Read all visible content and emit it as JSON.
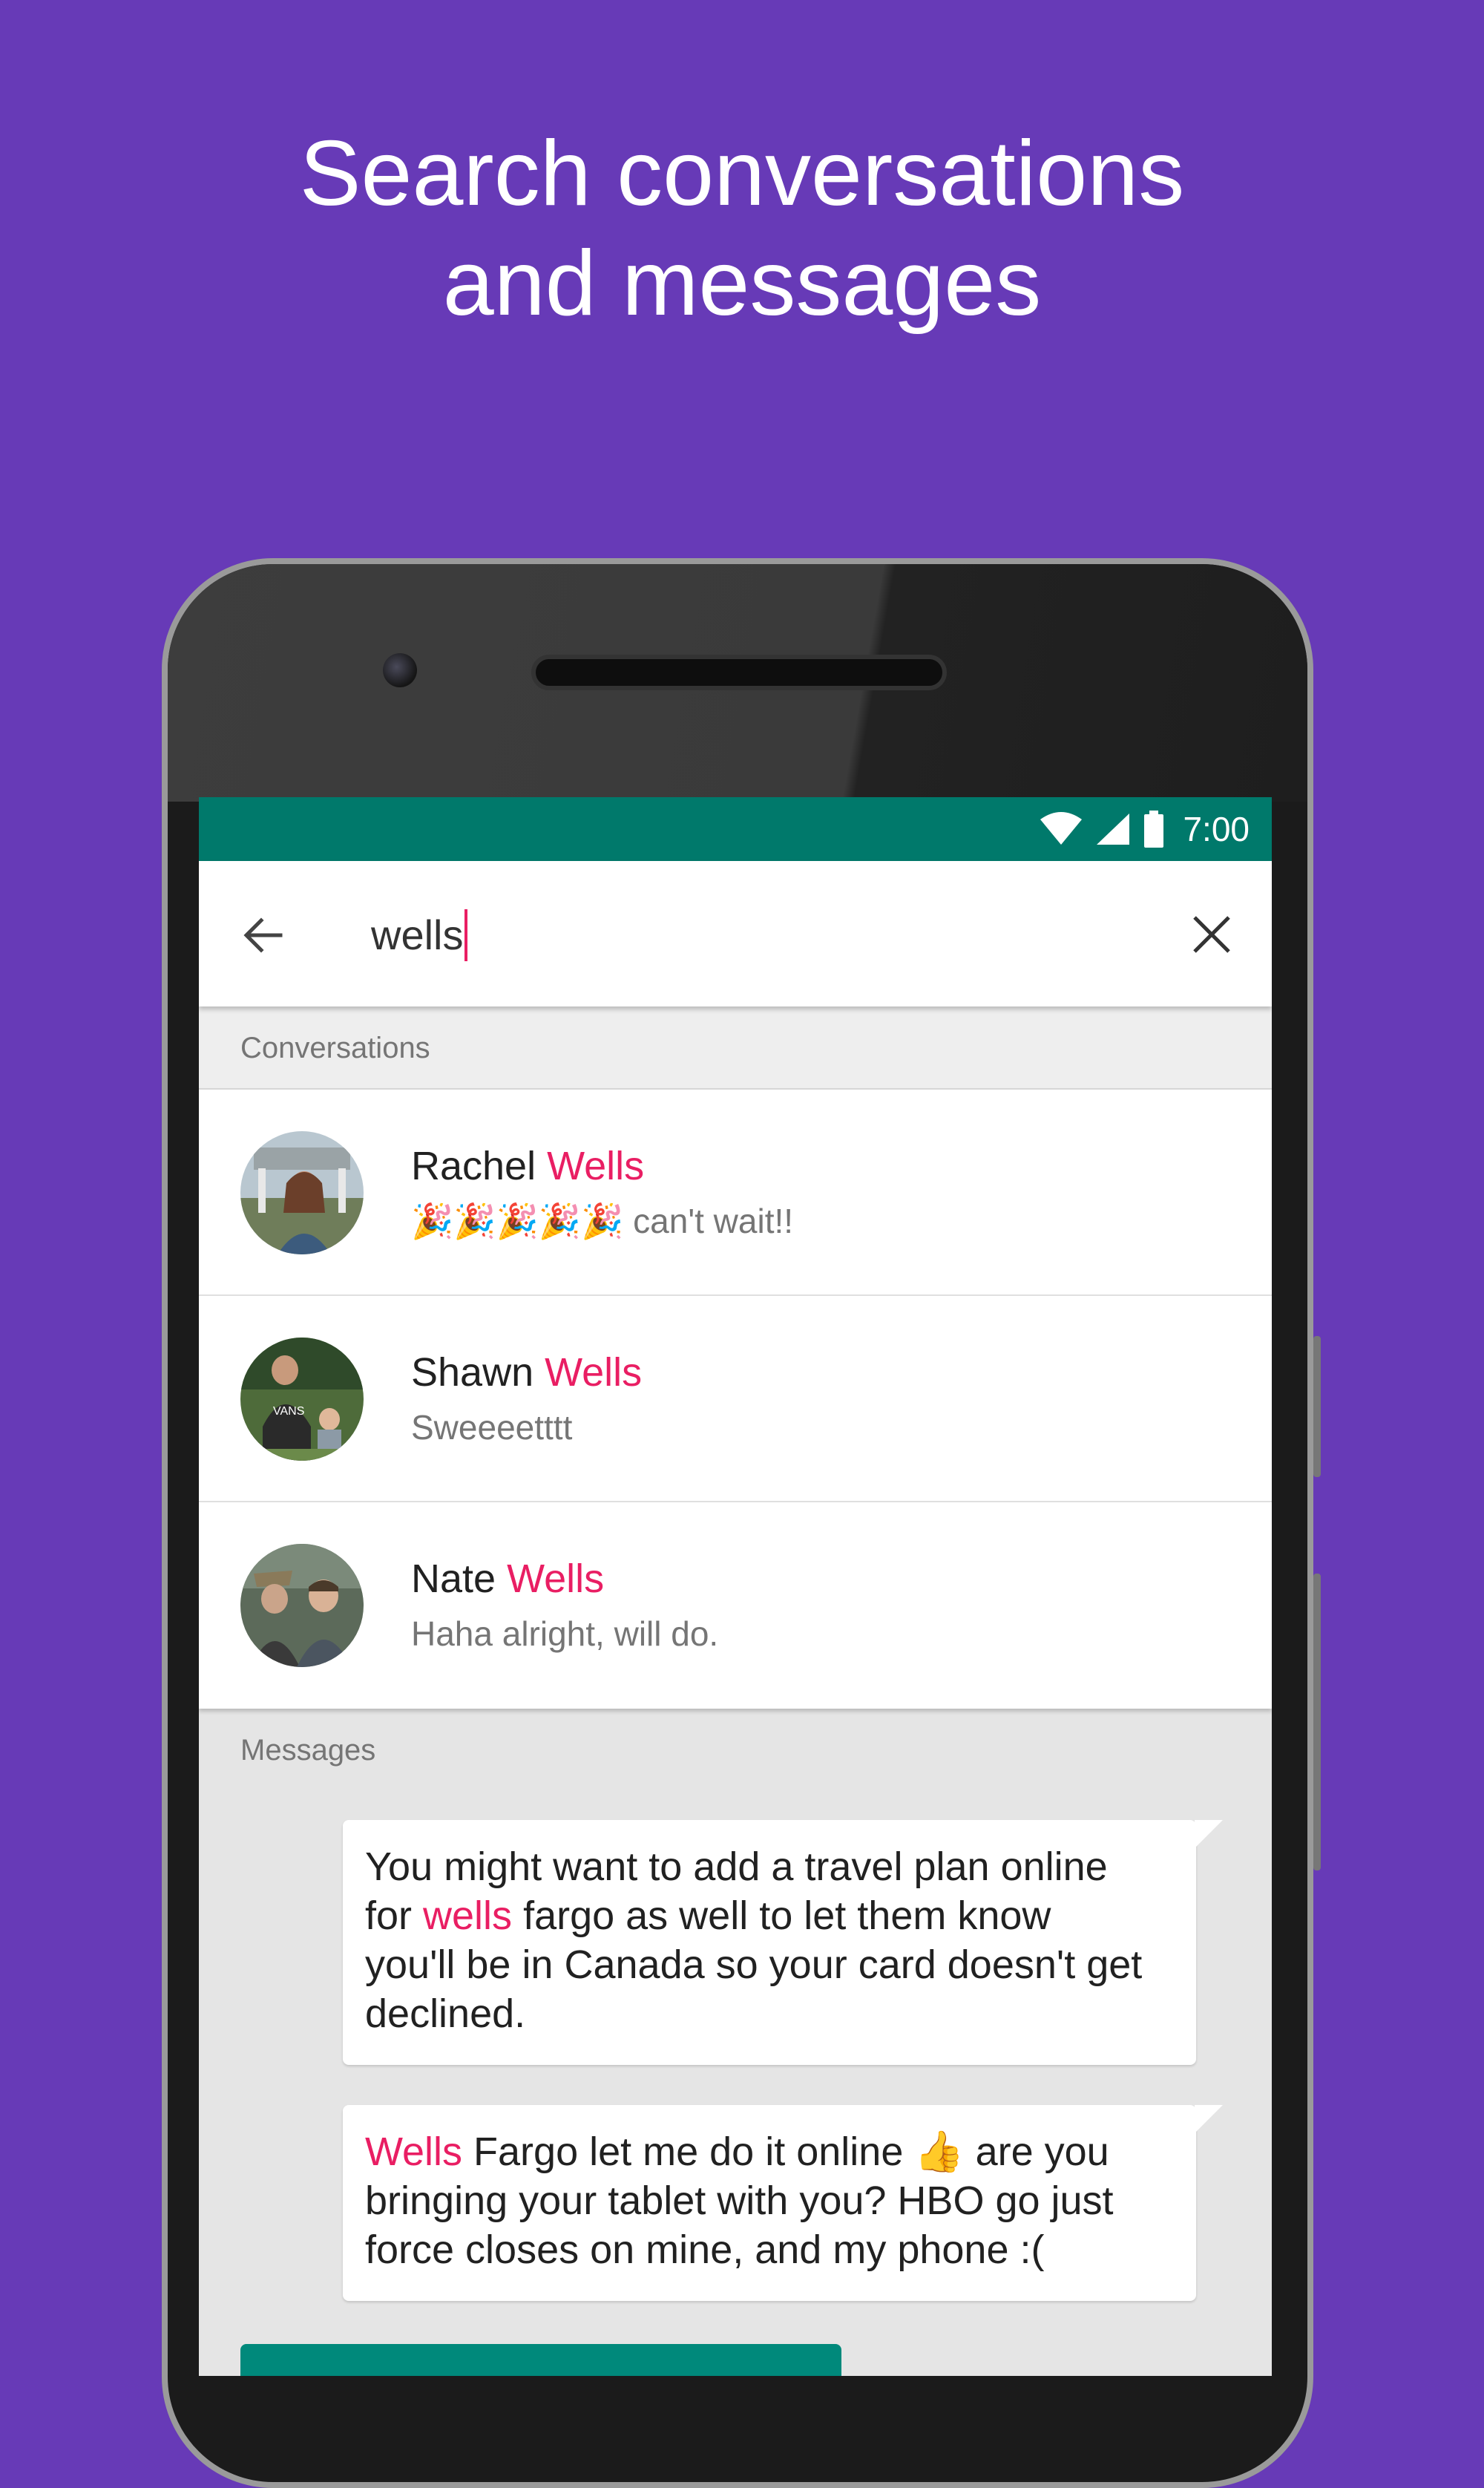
{
  "headline": {
    "line1": "Search conversations",
    "line2": "and messages"
  },
  "colors": {
    "background": "#673ab7",
    "status_bar": "#00796b",
    "highlight": "#e91e63",
    "outgoing_bubble": "#00897b"
  },
  "status_bar": {
    "time": "7:00",
    "icons": [
      "wifi-icon",
      "signal-icon",
      "battery-icon"
    ]
  },
  "search": {
    "query": "wells",
    "back_icon": "arrow-back-icon",
    "clear_icon": "close-icon"
  },
  "conversations": {
    "header": "Conversations",
    "items": [
      {
        "first_name": "Rachel",
        "last_name": "Wells",
        "snippet_emoji": "🎉🎉🎉🎉🎉",
        "snippet": "can't wait!!"
      },
      {
        "first_name": "Shawn",
        "last_name": "Wells",
        "snippet_emoji": "",
        "snippet": "Sweeeetttt"
      },
      {
        "first_name": "Nate",
        "last_name": "Wells",
        "snippet_emoji": "",
        "snippet": "Haha alright, will do."
      }
    ]
  },
  "messages": {
    "header": "Messages",
    "items": [
      {
        "line1": "You might want to add a travel plan online",
        "line2_pre": "for ",
        "line2_hl": "wells",
        "line2_post": " fargo as well to let them know",
        "line3": "you'll be in Canada so your card doesn't get",
        "line4": "declined."
      },
      {
        "line1_hl": "Wells",
        "line1_post": " Fargo let me do it online 👍 are you",
        "line2": "bringing your tablet with you? HBO go just",
        "line3": "force closes on mine, and my phone :("
      }
    ]
  }
}
